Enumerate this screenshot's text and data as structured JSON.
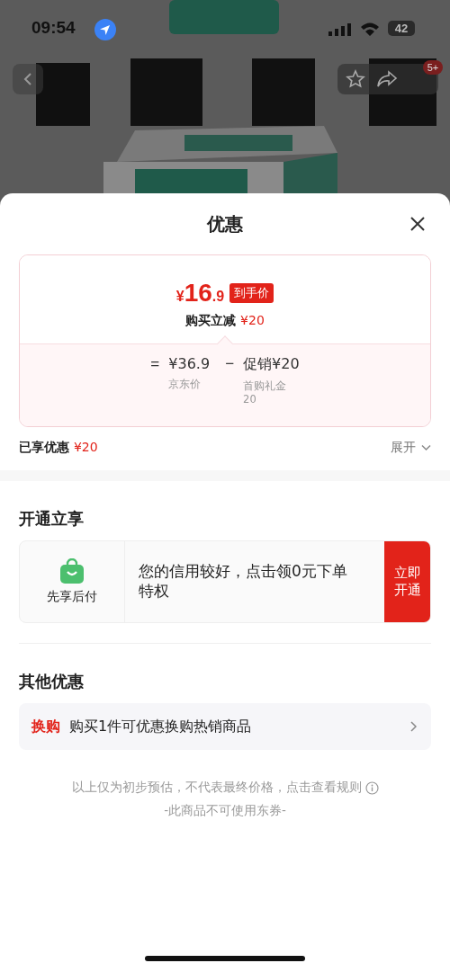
{
  "status_bar": {
    "time": "09:54",
    "battery": "42"
  },
  "product_header": {
    "kind": "picture",
    "cart_badge": "5+"
  },
  "sheet": {
    "title": "优惠",
    "price_card": {
      "final_price": {
        "currency": "¥",
        "integer": "16",
        "decimal": ".9"
      },
      "price_tag": "到手价",
      "instant_discount": {
        "label": "购买立减",
        "amount": "¥20"
      },
      "breakdown": [
        {
          "operator": "=",
          "amount": "¥36.9",
          "caption": "京东价"
        },
        {
          "operator": "−",
          "amount": "促销¥20",
          "caption": "首购礼金20"
        }
      ]
    },
    "enjoyed": {
      "label": "已享优惠",
      "amount": "¥20"
    },
    "expand": {
      "label": "展开",
      "expanded": false
    },
    "activate_section": {
      "title": "开通立享",
      "offer": {
        "name": "先享后付",
        "description": "您的信用较好，点击领0元下单特权",
        "button": "立即开通"
      }
    },
    "other_section": {
      "title": "其他优惠",
      "items": [
        {
          "tag": "换购",
          "text": "购买1件可优惠换购热销商品"
        }
      ]
    },
    "notes": {
      "disclaimer": "以上仅为初步预估，不代表最终价格，点击查看规则",
      "coupon_note": "-此商品不可使用东券-"
    }
  }
}
